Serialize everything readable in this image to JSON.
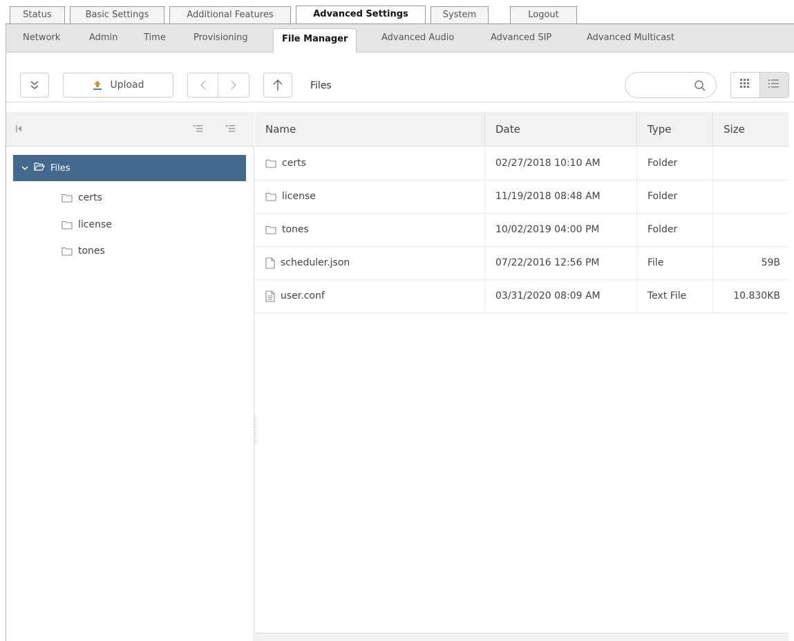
{
  "top_tabs": [
    "Status",
    "Basic Settings",
    "Additional Features",
    "Advanced Settings",
    "System",
    "Logout"
  ],
  "sub_tabs": [
    "Network",
    "Admin",
    "Time",
    "Provisioning",
    "File Manager",
    "Advanced Audio",
    "Advanced SIP",
    "Advanced Multicast"
  ],
  "toolbar": {
    "upload_label": "Upload",
    "breadcrumb": "Files"
  },
  "icons": {
    "expand": "chevrons-down-icon",
    "upload": "upload-icon",
    "back": "chevron-left-icon",
    "forward": "chevron-right-icon",
    "up": "arrow-up-icon",
    "search": "search-icon",
    "grid_view": "grid-view-icon",
    "list_view": "list-view-icon"
  },
  "tree": {
    "root": "Files",
    "children": [
      "certs",
      "license",
      "tones"
    ]
  },
  "grid": {
    "columns": [
      "Name",
      "Date",
      "Type",
      "Size"
    ],
    "rows": [
      {
        "name": "certs",
        "date": "02/27/2018 10:10 AM",
        "type": "Folder",
        "size": "",
        "icon": "folder-icon"
      },
      {
        "name": "license",
        "date": "11/19/2018 08:48 AM",
        "type": "Folder",
        "size": "",
        "icon": "folder-icon"
      },
      {
        "name": "tones",
        "date": "10/02/2019 04:00 PM",
        "type": "Folder",
        "size": "",
        "icon": "folder-icon"
      },
      {
        "name": "scheduler.json",
        "date": "07/22/2016 12:56 PM",
        "type": "File",
        "size": "59B",
        "icon": "file-icon"
      },
      {
        "name": "user.conf",
        "date": "03/31/2020 08:09 AM",
        "type": "Text File",
        "size": "10.830KB",
        "icon": "text-file-icon"
      }
    ]
  },
  "colors": {
    "selected": "#44698f",
    "header_bg": "#f2f2f2",
    "subtabs_bg": "#e6e6e6"
  }
}
